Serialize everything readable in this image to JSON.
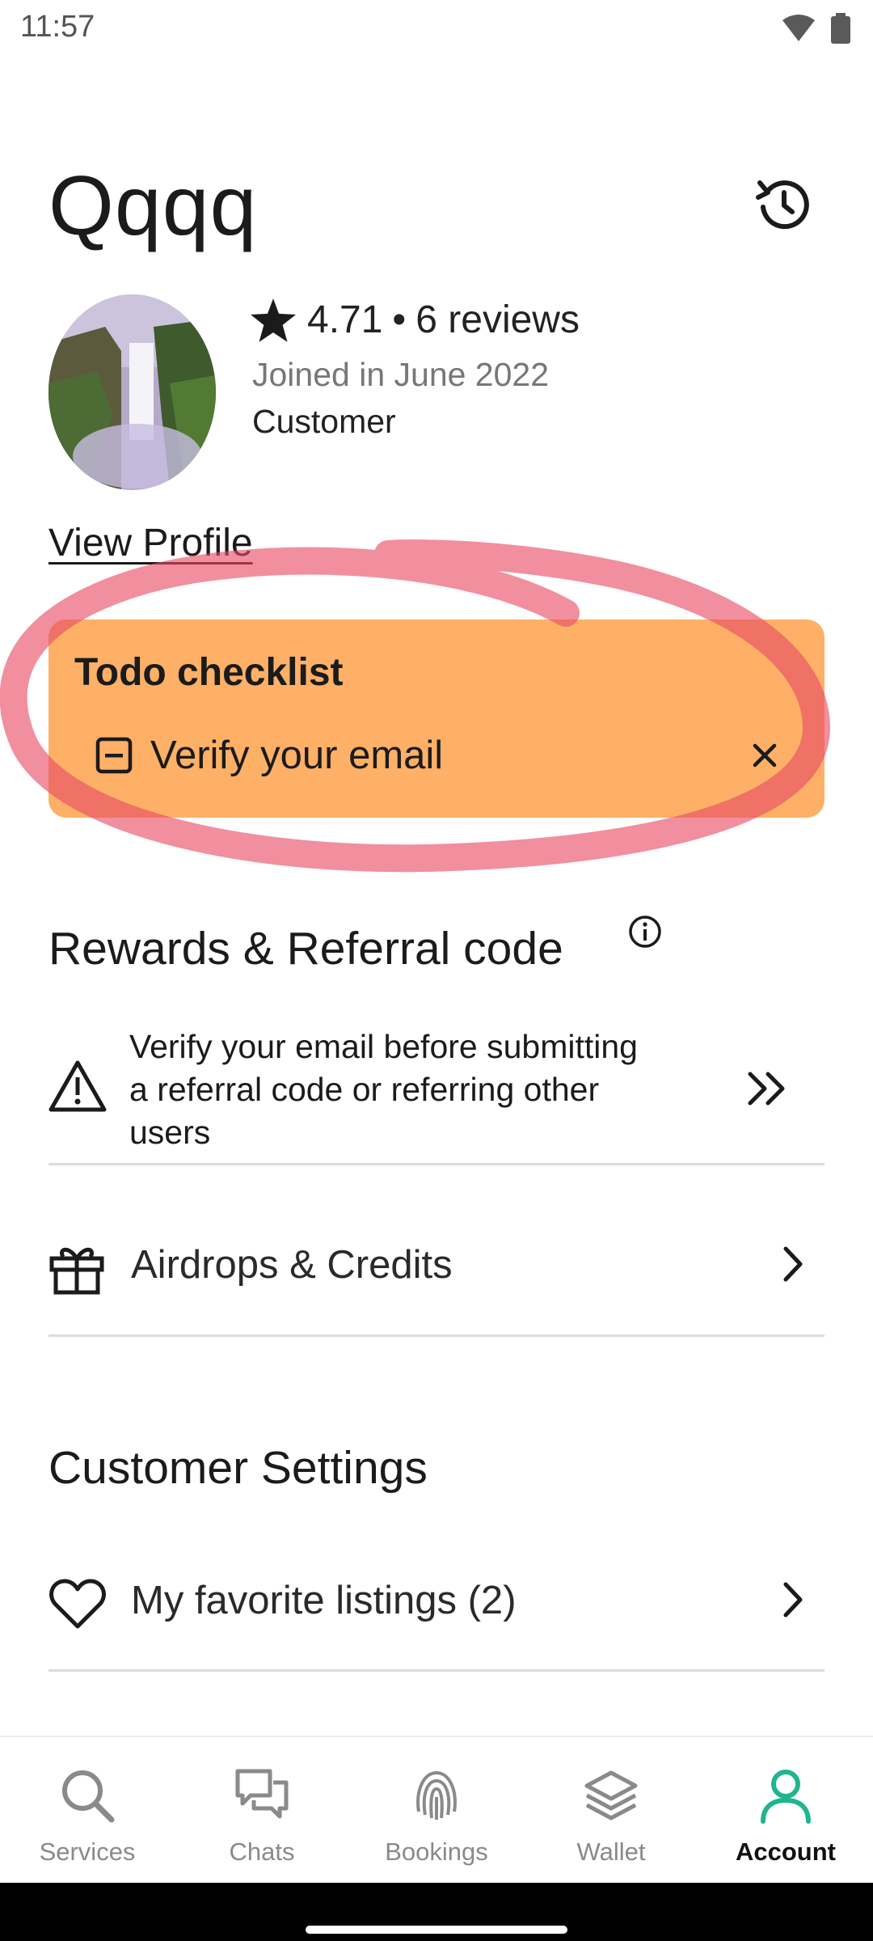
{
  "status": {
    "time": "11:57"
  },
  "profile": {
    "name": "Qqqq",
    "rating": "4.71",
    "separator": "•",
    "reviews": "6 reviews",
    "joined": "Joined in June 2022",
    "role": "Customer",
    "view_profile_label": "View Profile"
  },
  "todo": {
    "title": "Todo checklist",
    "items": [
      {
        "label": "Verify your email"
      }
    ],
    "card_color": "#fdb066",
    "highlight_color": "#e84a64"
  },
  "rewards": {
    "title": "Rewards & Referral code",
    "warning": "Verify your email before submitting a referral code or referring other users",
    "airdrops_label": "Airdrops & Credits"
  },
  "customer_settings": {
    "title": "Customer Settings",
    "favorites_label": "My favorite listings (2)"
  },
  "nav": {
    "items": [
      {
        "label": "Services",
        "icon": "search-icon"
      },
      {
        "label": "Chats",
        "icon": "chats-icon"
      },
      {
        "label": "Bookings",
        "icon": "fingerprint-icon"
      },
      {
        "label": "Wallet",
        "icon": "layers-icon"
      },
      {
        "label": "Account",
        "icon": "person-icon",
        "active": true
      }
    ],
    "active_color": "#1fb58f"
  }
}
